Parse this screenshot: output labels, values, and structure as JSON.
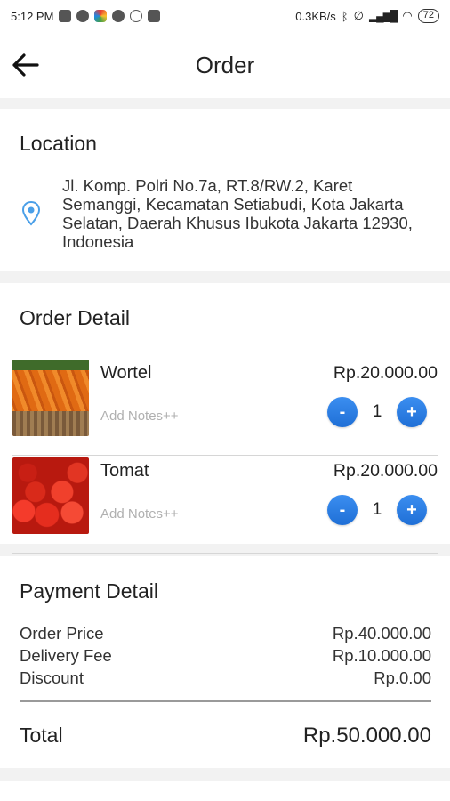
{
  "status_bar": {
    "time": "5:12 PM",
    "network_speed": "0.3KB/s",
    "signal": "▂▄▆█",
    "battery": "72"
  },
  "app_bar": {
    "title": "Order",
    "back_icon": "arrow-left-icon"
  },
  "location": {
    "title": "Location",
    "icon": "location-pin-icon",
    "address": "Jl. Komp. Polri No.7a, RT.8/RW.2, Karet Semanggi, Kecamatan Setiabudi, Kota Jakarta Selatan, Daerah Khusus Ibukota Jakarta 12930, Indonesia"
  },
  "order_detail": {
    "title": "Order Detail",
    "items": [
      {
        "name": "Wortel",
        "price": "Rp.20.000.00",
        "notes_placeholder": "Add Notes++",
        "quantity": "1",
        "minus": "-",
        "plus": "+"
      },
      {
        "name": "Tomat",
        "price": "Rp.20.000.00",
        "notes_placeholder": "Add Notes++",
        "quantity": "1",
        "minus": "-",
        "plus": "+"
      }
    ]
  },
  "payment_detail": {
    "title": "Payment Detail",
    "rows": [
      {
        "label": "Order Price",
        "value": "Rp.40.000.00"
      },
      {
        "label": "Delivery Fee",
        "value": "Rp.10.000.00"
      },
      {
        "label": "Discount",
        "value": "Rp.0.00"
      }
    ],
    "total_label": "Total",
    "total_value": "Rp.50.000.00"
  },
  "colors": {
    "accent": "#1f6fd6",
    "pin": "#4a9fe8",
    "background": "#f2f2f2"
  }
}
